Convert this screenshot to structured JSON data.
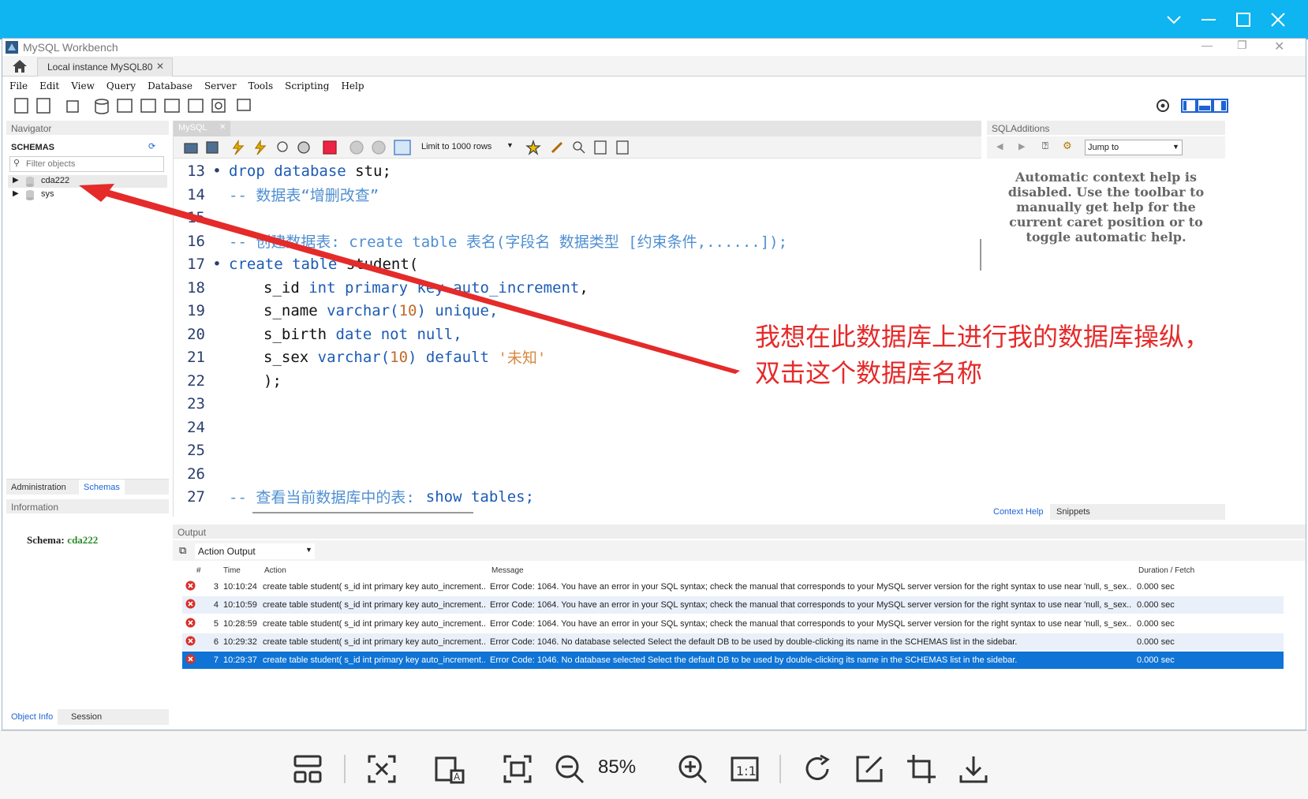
{
  "app": {
    "title": "MySQL Workbench",
    "tab": "Local instance MySQL80"
  },
  "menu": [
    "File",
    "Edit",
    "View",
    "Query",
    "Database",
    "Server",
    "Tools",
    "Scripting",
    "Help"
  ],
  "navigator": {
    "header": "Navigator",
    "schemas_title": "SCHEMAS",
    "filter_placeholder": "Filter objects",
    "schemas": [
      "cda222",
      "sys"
    ],
    "tabs": [
      "Administration",
      "Schemas"
    ],
    "info_header": "Information",
    "schema_label": "Schema:",
    "schema_value": "cda222",
    "bottom_tabs": [
      "Object Info",
      "Session"
    ]
  },
  "editor": {
    "tab": "MySQL",
    "limit": "Limit to 1000 rows",
    "lines": {
      "l13": {
        "n": "13",
        "a": "drop database",
        "b": " stu;"
      },
      "l14": {
        "n": "14",
        "c": "-- 数据表“增删改查”"
      },
      "l15": {
        "n": "15"
      },
      "l16": {
        "n": "16",
        "c": "-- 创建数据表: create table 表名(字段名 数据类型 [约束条件,......]);"
      },
      "l17": {
        "n": "17",
        "a": "create table",
        "b": " student("
      },
      "l18": {
        "n": "18",
        "a": "s_id",
        "b": " int primary key auto_increment",
        ",": ","
      },
      "l19": {
        "n": "19",
        "a": "s_name",
        "b": " varchar(",
        "num": "10",
        "c": ") unique,"
      },
      "l20": {
        "n": "20",
        "a": "s_birth",
        "b": " date not null,"
      },
      "l21": {
        "n": "21",
        "a": "s_sex",
        "b": " varchar(",
        "num": "10",
        "c": ") default ",
        "s": "'未知'"
      },
      "l22": {
        "n": "22",
        "a": ");"
      },
      "l23": {
        "n": "23"
      },
      "l24": {
        "n": "24"
      },
      "l25": {
        "n": "25"
      },
      "l26": {
        "n": "26"
      },
      "l27": {
        "n": "27",
        "c": "-- 查看当前数据库中的表:",
        "kw": "show tables;"
      }
    }
  },
  "annotation": {
    "line1": "我想在此数据库上进行我的数据库操纵，",
    "line2": "双击这个数据库名称",
    "color": "#e52a2a"
  },
  "sql_additions": {
    "header": "SQLAdditions",
    "jump": "Jump to",
    "help": "Automatic context help is disabled. Use the toolbar to manually get help for the current caret position or to toggle automatic help.",
    "tabs": [
      "Context Help",
      "Snippets"
    ]
  },
  "output": {
    "header": "Output",
    "mode": "Action Output",
    "columns": {
      "num": "#",
      "time": "Time",
      "action": "Action",
      "message": "Message",
      "duration": "Duration / Fetch"
    },
    "rows": [
      {
        "n": "3",
        "time": "10:10:24",
        "action": "create table student( s_id int primary key auto_increment...",
        "message": "Error Code: 1064. You have an error in your SQL syntax; check the manual that corresponds to your MySQL server version for the right syntax to use near 'null,     s_sex...",
        "dur": "0.000 sec"
      },
      {
        "n": "4",
        "time": "10:10:59",
        "action": "create table student( s_id int primary key auto_increment...",
        "message": "Error Code: 1064. You have an error in your SQL syntax; check the manual that corresponds to your MySQL server version for the right syntax to use near 'null,     s_sex...",
        "dur": "0.000 sec"
      },
      {
        "n": "5",
        "time": "10:28:59",
        "action": "create table student( s_id int primary key auto_increment...",
        "message": "Error Code: 1064. You have an error in your SQL syntax; check the manual that corresponds to your MySQL server version for the right syntax to use near 'null,     s_sex...",
        "dur": "0.000 sec"
      },
      {
        "n": "6",
        "time": "10:29:32",
        "action": "create table student( s_id int primary key auto_increment...",
        "message": "Error Code: 1046. No database selected Select the default DB to be used by double-clicking its name in the SCHEMAS list in the sidebar.",
        "dur": "0.000 sec"
      },
      {
        "n": "7",
        "time": "10:29:37",
        "action": "create table student( s_id int primary key auto_increment...",
        "message": "Error Code: 1046. No database selected Select the default DB to be used by double-clicking its name in the SCHEMAS list in the sidebar.",
        "dur": "0.000 sec"
      }
    ]
  },
  "viewer": {
    "zoom": "85%"
  }
}
